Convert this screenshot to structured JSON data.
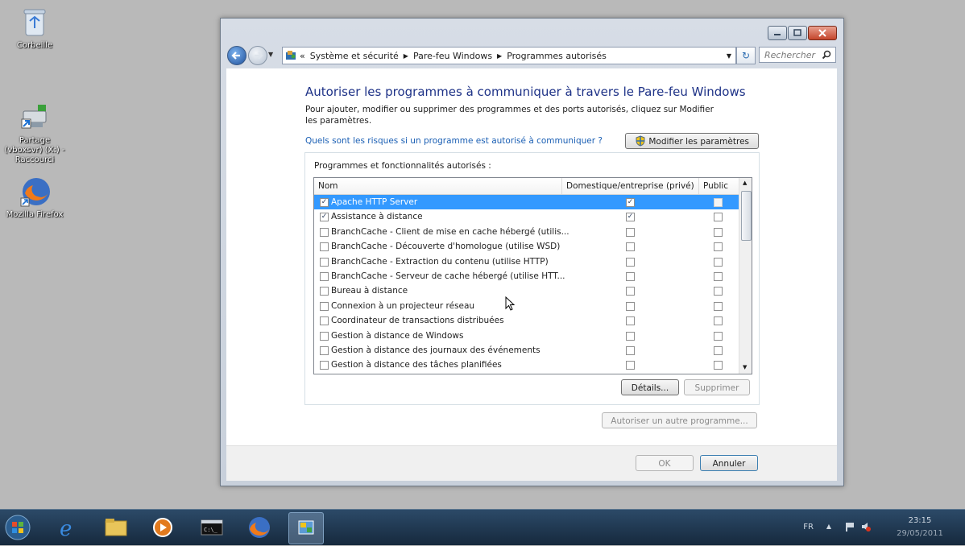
{
  "desktop": {
    "icons": [
      {
        "label": "Corbeille",
        "icon": "recycle-bin-icon"
      },
      {
        "label": "Partage (vboxsvr) (X:) - Raccourci",
        "icon": "network-share-icon"
      },
      {
        "label": "Mozilla Firefox",
        "icon": "firefox-icon"
      }
    ]
  },
  "window": {
    "breadcrumb": {
      "overflow": "«",
      "items": [
        "Système et sécurité",
        "Pare-feu Windows",
        "Programmes autorisés"
      ]
    },
    "search_placeholder": "Rechercher",
    "title": "Autoriser les programmes à communiquer à travers le Pare-feu Windows",
    "description": "Pour ajouter, modifier ou supprimer des programmes et des ports autorisés, cliquez sur Modifier les paramètres.",
    "risk_link": "Quels sont les risques si un programme est autorisé à communiquer ?",
    "modify_button": "Modifier les paramètres",
    "group_label": "Programmes et fonctionnalités autorisés :",
    "columns": {
      "name": "Nom",
      "private": "Domestique/entreprise (privé)",
      "public": "Public"
    },
    "programs": [
      {
        "name": "Apache HTTP Server",
        "enabled": true,
        "private": true,
        "public": false,
        "selected": true
      },
      {
        "name": "Assistance à distance",
        "enabled": true,
        "private": true,
        "public": false,
        "selected": false
      },
      {
        "name": "BranchCache - Client de mise en cache hébergé (utilis...",
        "enabled": false,
        "private": false,
        "public": false,
        "selected": false
      },
      {
        "name": "BranchCache - Découverte d'homologue (utilise WSD)",
        "enabled": false,
        "private": false,
        "public": false,
        "selected": false
      },
      {
        "name": "BranchCache - Extraction du contenu (utilise HTTP)",
        "enabled": false,
        "private": false,
        "public": false,
        "selected": false
      },
      {
        "name": "BranchCache - Serveur de cache hébergé (utilise HTT...",
        "enabled": false,
        "private": false,
        "public": false,
        "selected": false
      },
      {
        "name": "Bureau à distance",
        "enabled": false,
        "private": false,
        "public": false,
        "selected": false
      },
      {
        "name": "Connexion à un projecteur réseau",
        "enabled": false,
        "private": false,
        "public": false,
        "selected": false
      },
      {
        "name": "Coordinateur de transactions distribuées",
        "enabled": false,
        "private": false,
        "public": false,
        "selected": false
      },
      {
        "name": "Gestion à distance de Windows",
        "enabled": false,
        "private": false,
        "public": false,
        "selected": false
      },
      {
        "name": "Gestion à distance des journaux des événements",
        "enabled": false,
        "private": false,
        "public": false,
        "selected": false
      },
      {
        "name": "Gestion à distance des tâches planifiées",
        "enabled": false,
        "private": false,
        "public": false,
        "selected": false
      }
    ],
    "details_button": "Détails...",
    "remove_button": "Supprimer",
    "allow_other_button": "Autoriser un autre programme...",
    "ok_button": "OK",
    "cancel_button": "Annuler"
  },
  "taskbar": {
    "apps": [
      "windows-start-icon",
      "internet-explorer-icon",
      "explorer-folder-icon",
      "media-player-icon",
      "command-prompt-icon",
      "firefox-icon",
      "control-panel-icon"
    ],
    "language": "FR",
    "time": "23:15",
    "date": "29/05/2011"
  }
}
